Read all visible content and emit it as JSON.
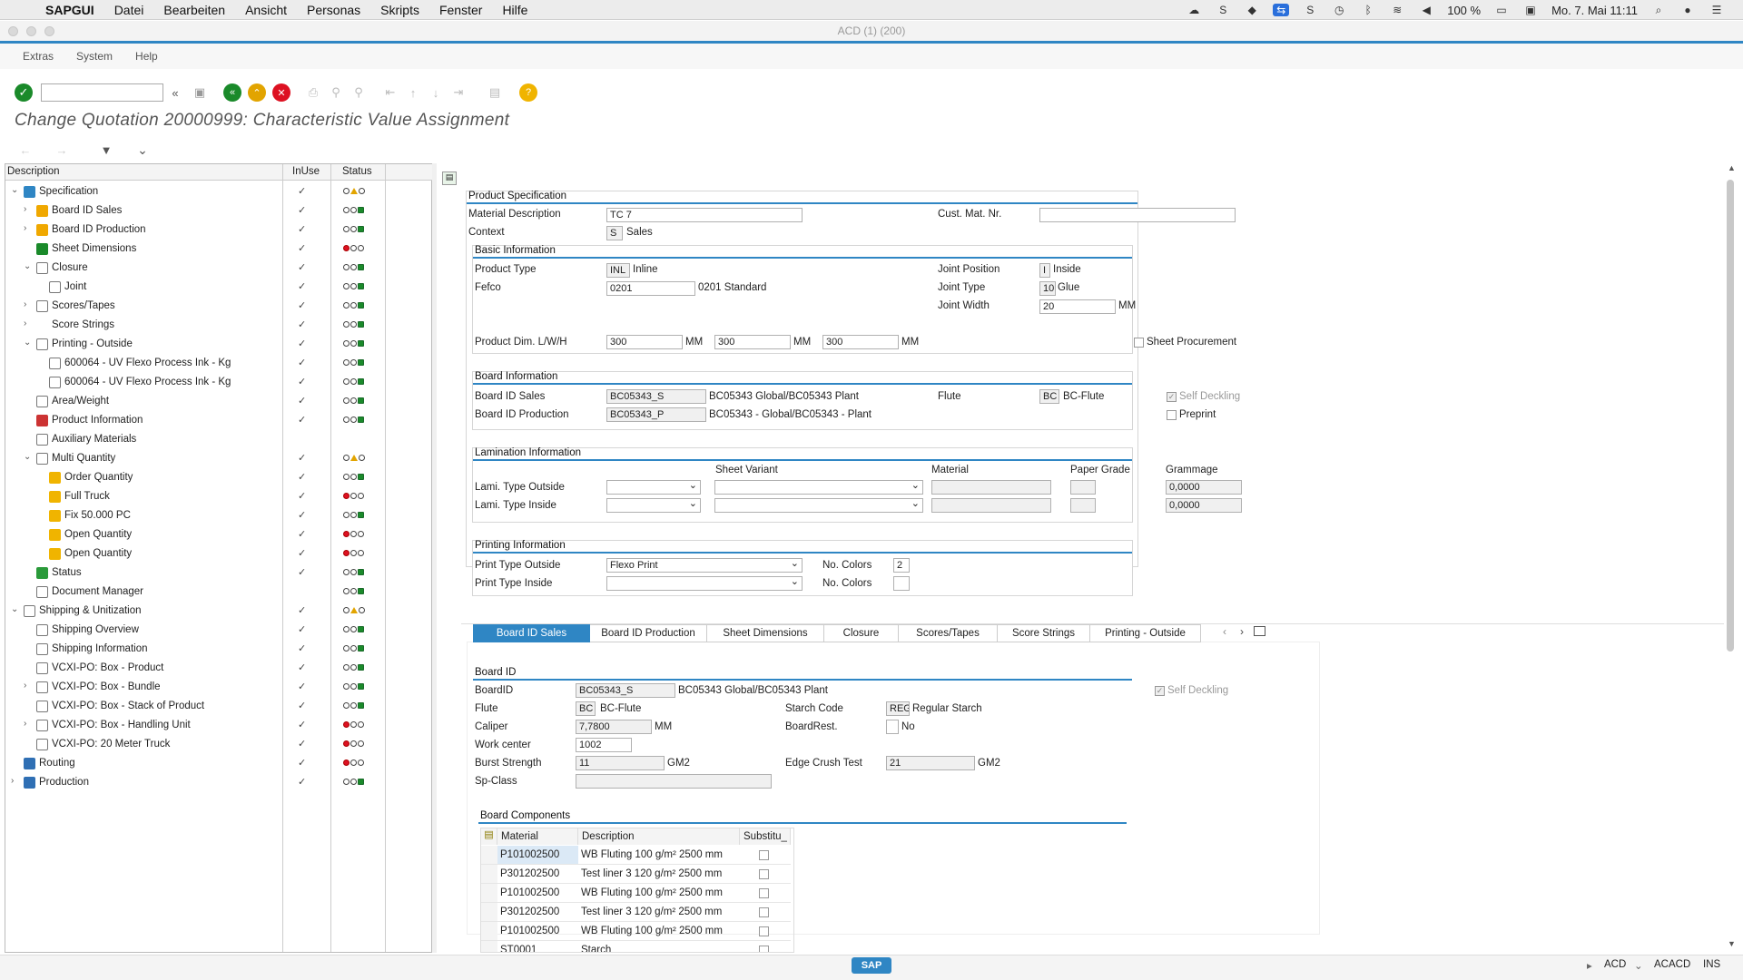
{
  "mac_menu": {
    "app": "SAPGUI",
    "items": [
      "Datei",
      "Bearbeiten",
      "Ansicht",
      "Personas",
      "Skripts",
      "Fenster",
      "Hilfe"
    ],
    "battery": "100 %",
    "datetime": "Mo. 7. Mai  11:11"
  },
  "window_title": "ACD (1) (200)",
  "sap_menu": [
    "Extras",
    "System",
    "Help"
  ],
  "page_title": "Change Quotation 20000999: Characteristic Value Assignment",
  "tree": {
    "headers": {
      "desc": "Description",
      "inuse": "InUse",
      "status": "Status"
    },
    "rows": [
      {
        "level": 0,
        "arrow": "open",
        "icon": "gear-icon",
        "label": "Specification",
        "checked": true,
        "status": "mixed"
      },
      {
        "level": 1,
        "arrow": "closed",
        "icon": "board-icon",
        "label": "Board ID Sales",
        "checked": true,
        "status": "green"
      },
      {
        "level": 1,
        "arrow": "closed",
        "icon": "board-icon",
        "label": "Board ID Production",
        "checked": true,
        "status": "green"
      },
      {
        "level": 1,
        "arrow": "",
        "icon": "dimension-icon",
        "label": "Sheet Dimensions",
        "checked": true,
        "status": "red"
      },
      {
        "level": 1,
        "arrow": "open",
        "icon": "closure-icon",
        "label": "Closure",
        "checked": true,
        "status": "green"
      },
      {
        "level": 2,
        "arrow": "",
        "icon": "joint-icon",
        "label": "Joint",
        "checked": true,
        "status": "green"
      },
      {
        "level": 1,
        "arrow": "closed",
        "icon": "scores-icon",
        "label": "Scores/Tapes",
        "checked": true,
        "status": "green"
      },
      {
        "level": 1,
        "arrow": "closed",
        "icon": "",
        "label": "Score Strings",
        "checked": true,
        "status": "green"
      },
      {
        "level": 1,
        "arrow": "open",
        "icon": "printer-icon",
        "label": "Printing - Outside",
        "checked": true,
        "status": "green"
      },
      {
        "level": 2,
        "arrow": "",
        "icon": "ink-icon",
        "label": "600064 - UV Flexo Process Ink - Kg",
        "checked": true,
        "status": "green"
      },
      {
        "level": 2,
        "arrow": "",
        "icon": "ink-icon",
        "label": "600064 - UV Flexo Process Ink - Kg",
        "checked": true,
        "status": "green"
      },
      {
        "level": 1,
        "arrow": "",
        "icon": "area-icon",
        "label": "Area/Weight",
        "checked": true,
        "status": "green"
      },
      {
        "level": 1,
        "arrow": "",
        "icon": "info-icon",
        "label": "Product Information",
        "checked": true,
        "status": "green"
      },
      {
        "level": 1,
        "arrow": "",
        "icon": "material-icon",
        "label": "Auxiliary Materials",
        "checked": false,
        "status": "none"
      },
      {
        "level": 1,
        "arrow": "open",
        "icon": "chart-icon",
        "label": "Multi Quantity",
        "checked": true,
        "status": "mixed"
      },
      {
        "level": 2,
        "arrow": "",
        "icon": "qty-icon",
        "label": "Order Quantity",
        "checked": true,
        "status": "green"
      },
      {
        "level": 2,
        "arrow": "",
        "icon": "qty-icon",
        "label": "Full Truck",
        "checked": true,
        "status": "red"
      },
      {
        "level": 2,
        "arrow": "",
        "icon": "qty-icon",
        "label": "Fix 50.000 PC",
        "checked": true,
        "status": "green"
      },
      {
        "level": 2,
        "arrow": "",
        "icon": "qty-icon",
        "label": "Open Quantity",
        "checked": true,
        "status": "red"
      },
      {
        "level": 2,
        "arrow": "",
        "icon": "qty-icon",
        "label": "Open Quantity",
        "checked": true,
        "status": "red"
      },
      {
        "level": 1,
        "arrow": "",
        "icon": "status-icon",
        "label": "Status",
        "checked": true,
        "status": "green"
      },
      {
        "level": 1,
        "arrow": "",
        "icon": "document-icon",
        "label": "Document Manager",
        "checked": false,
        "status": "green"
      },
      {
        "level": 0,
        "arrow": "open",
        "icon": "shipping-icon",
        "label": "Shipping & Unitization",
        "checked": true,
        "status": "mixed"
      },
      {
        "level": 1,
        "arrow": "",
        "icon": "overview-icon",
        "label": "Shipping Overview",
        "checked": true,
        "status": "green"
      },
      {
        "level": 1,
        "arrow": "",
        "icon": "shipinfo-icon",
        "label": "Shipping Information",
        "checked": true,
        "status": "green"
      },
      {
        "level": 1,
        "arrow": "",
        "icon": "cycle-icon",
        "label": "VCXI-PO: Box - Product",
        "checked": true,
        "status": "green"
      },
      {
        "level": 1,
        "arrow": "closed",
        "icon": "cycle-icon",
        "label": "VCXI-PO: Box - Bundle",
        "checked": true,
        "status": "green"
      },
      {
        "level": 1,
        "arrow": "",
        "icon": "cycle-icon",
        "label": "VCXI-PO: Box - Stack of Product",
        "checked": true,
        "status": "green"
      },
      {
        "level": 1,
        "arrow": "closed",
        "icon": "cycle-icon",
        "label": "VCXI-PO: Box - Handling Unit",
        "checked": true,
        "status": "red"
      },
      {
        "level": 1,
        "arrow": "",
        "icon": "cycle-icon",
        "label": "VCXI-PO: 20 Meter Truck",
        "checked": true,
        "status": "red"
      },
      {
        "level": 0,
        "arrow": "",
        "icon": "routing-icon",
        "label": "Routing",
        "checked": true,
        "status": "red"
      },
      {
        "level": 0,
        "arrow": "closed",
        "icon": "production-icon",
        "label": "Production",
        "checked": true,
        "status": "green"
      }
    ]
  },
  "product_spec": {
    "title": "Product Specification",
    "material_desc_label": "Material Description",
    "material_desc": "TC  7",
    "cust_mat_label": "Cust. Mat. Nr.",
    "cust_mat": "",
    "context_label": "Context",
    "context_code": "S",
    "context_text": "Sales"
  },
  "basic_info": {
    "title": "Basic Information",
    "product_type_label": "Product Type",
    "product_type_code": "INL",
    "product_type_text": "Inline",
    "fefco_label": "Fefco",
    "fefco": "0201",
    "fefco_text": "0201 Standard",
    "joint_pos_label": "Joint Position",
    "joint_pos_code": "I",
    "joint_pos_text": "Inside",
    "joint_type_label": "Joint Type",
    "joint_type_code": "10",
    "joint_type_text": "Glue",
    "joint_width_label": "Joint Width",
    "joint_width": "20",
    "joint_width_unit": "MM",
    "dim_label": "Product Dim. L/W/H",
    "dim_l": "300",
    "dim_w": "300",
    "dim_h": "300",
    "dim_unit": "MM",
    "sheet_proc_label": "Sheet Procurement"
  },
  "board_info": {
    "title": "Board Information",
    "sales_label": "Board ID Sales",
    "sales_id": "BC05343_S",
    "sales_text": "BC05343 Global/BC05343 Plant",
    "prod_label": "Board ID Production",
    "prod_id": "BC05343_P",
    "prod_text": "BC05343 - Global/BC05343 - Plant",
    "flute_label": "Flute",
    "flute_code": "BC",
    "flute_text": "BC-Flute",
    "self_deckling": "Self Deckling",
    "preprint": "Preprint"
  },
  "lamination": {
    "title": "Lamination Information",
    "col_variant": "Sheet Variant",
    "col_material": "Material",
    "col_paper": "Paper Grade",
    "col_grammage": "Grammage",
    "outside_label": "Lami. Type Outside",
    "inside_label": "Lami. Type Inside",
    "grammage_out": "0,0000",
    "grammage_in": "0,0000"
  },
  "printing": {
    "title": "Printing Information",
    "outside_label": "Print Type Outside",
    "outside_value": "Flexo Print",
    "inside_label": "Print Type Inside",
    "inside_value": "",
    "colors_label": "No. Colors",
    "colors_out": "2",
    "colors_in": ""
  },
  "tabs": [
    "Board ID Sales",
    "Board ID Production",
    "Sheet Dimensions",
    "Closure",
    "Scores/Tapes",
    "Score Strings",
    "Printing - Outside"
  ],
  "board_id": {
    "title": "Board ID",
    "boardid_label": "BoardID",
    "boardid": "BC05343_S",
    "boardid_text": "BC05343 Global/BC05343 Plant",
    "self_deckling": "Self Deckling",
    "flute_label": "Flute",
    "flute_code": "BC",
    "flute_text": "BC-Flute",
    "starch_label": "Starch Code",
    "starch_code": "REG",
    "starch_text": "Regular Starch",
    "caliper_label": "Caliper",
    "caliper": "7,7800",
    "caliper_unit": "MM",
    "boardrest_label": "BoardRest.",
    "boardrest_text": "No",
    "workcenter_label": "Work center",
    "workcenter": "1002",
    "burst_label": "Burst Strength",
    "burst": "11",
    "burst_unit": "GM2",
    "ect_label": "Edge Crush Test",
    "ect": "21",
    "ect_unit": "GM2",
    "spclass_label": "Sp-Class"
  },
  "components": {
    "title": "Board Components",
    "headers": [
      "Material",
      "Description",
      "Substitu_"
    ],
    "rows": [
      [
        "P101002500",
        "WB Fluting 100 g/m² 2500 mm"
      ],
      [
        "P301202500",
        "Test liner 3 120 g/m² 2500 mm"
      ],
      [
        "P101002500",
        "WB Fluting 100 g/m² 2500 mm"
      ],
      [
        "P301202500",
        "Test liner 3 120 g/m² 2500 mm"
      ],
      [
        "P101002500",
        "WB Fluting 100 g/m² 2500 mm"
      ],
      [
        "ST0001",
        "Starch"
      ]
    ]
  },
  "statusbar": {
    "system": "ACD",
    "client": "ACACD",
    "mode": "INS"
  },
  "colors": {
    "accent": "#2f86c4",
    "green": "#1a8a2a",
    "red": "#d11122",
    "yellow": "#e2a400"
  }
}
